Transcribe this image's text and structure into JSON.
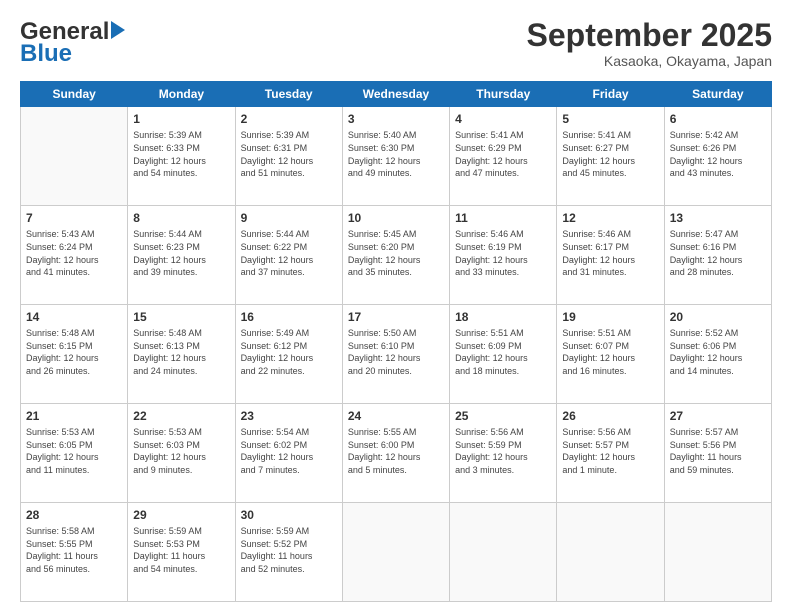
{
  "header": {
    "logo_general": "General",
    "logo_blue": "Blue",
    "month_title": "September 2025",
    "location": "Kasaoka, Okayama, Japan"
  },
  "days_of_week": [
    "Sunday",
    "Monday",
    "Tuesday",
    "Wednesday",
    "Thursday",
    "Friday",
    "Saturday"
  ],
  "weeks": [
    [
      {
        "num": "",
        "info": ""
      },
      {
        "num": "1",
        "info": "Sunrise: 5:39 AM\nSunset: 6:33 PM\nDaylight: 12 hours\nand 54 minutes."
      },
      {
        "num": "2",
        "info": "Sunrise: 5:39 AM\nSunset: 6:31 PM\nDaylight: 12 hours\nand 51 minutes."
      },
      {
        "num": "3",
        "info": "Sunrise: 5:40 AM\nSunset: 6:30 PM\nDaylight: 12 hours\nand 49 minutes."
      },
      {
        "num": "4",
        "info": "Sunrise: 5:41 AM\nSunset: 6:29 PM\nDaylight: 12 hours\nand 47 minutes."
      },
      {
        "num": "5",
        "info": "Sunrise: 5:41 AM\nSunset: 6:27 PM\nDaylight: 12 hours\nand 45 minutes."
      },
      {
        "num": "6",
        "info": "Sunrise: 5:42 AM\nSunset: 6:26 PM\nDaylight: 12 hours\nand 43 minutes."
      }
    ],
    [
      {
        "num": "7",
        "info": "Sunrise: 5:43 AM\nSunset: 6:24 PM\nDaylight: 12 hours\nand 41 minutes."
      },
      {
        "num": "8",
        "info": "Sunrise: 5:44 AM\nSunset: 6:23 PM\nDaylight: 12 hours\nand 39 minutes."
      },
      {
        "num": "9",
        "info": "Sunrise: 5:44 AM\nSunset: 6:22 PM\nDaylight: 12 hours\nand 37 minutes."
      },
      {
        "num": "10",
        "info": "Sunrise: 5:45 AM\nSunset: 6:20 PM\nDaylight: 12 hours\nand 35 minutes."
      },
      {
        "num": "11",
        "info": "Sunrise: 5:46 AM\nSunset: 6:19 PM\nDaylight: 12 hours\nand 33 minutes."
      },
      {
        "num": "12",
        "info": "Sunrise: 5:46 AM\nSunset: 6:17 PM\nDaylight: 12 hours\nand 31 minutes."
      },
      {
        "num": "13",
        "info": "Sunrise: 5:47 AM\nSunset: 6:16 PM\nDaylight: 12 hours\nand 28 minutes."
      }
    ],
    [
      {
        "num": "14",
        "info": "Sunrise: 5:48 AM\nSunset: 6:15 PM\nDaylight: 12 hours\nand 26 minutes."
      },
      {
        "num": "15",
        "info": "Sunrise: 5:48 AM\nSunset: 6:13 PM\nDaylight: 12 hours\nand 24 minutes."
      },
      {
        "num": "16",
        "info": "Sunrise: 5:49 AM\nSunset: 6:12 PM\nDaylight: 12 hours\nand 22 minutes."
      },
      {
        "num": "17",
        "info": "Sunrise: 5:50 AM\nSunset: 6:10 PM\nDaylight: 12 hours\nand 20 minutes."
      },
      {
        "num": "18",
        "info": "Sunrise: 5:51 AM\nSunset: 6:09 PM\nDaylight: 12 hours\nand 18 minutes."
      },
      {
        "num": "19",
        "info": "Sunrise: 5:51 AM\nSunset: 6:07 PM\nDaylight: 12 hours\nand 16 minutes."
      },
      {
        "num": "20",
        "info": "Sunrise: 5:52 AM\nSunset: 6:06 PM\nDaylight: 12 hours\nand 14 minutes."
      }
    ],
    [
      {
        "num": "21",
        "info": "Sunrise: 5:53 AM\nSunset: 6:05 PM\nDaylight: 12 hours\nand 11 minutes."
      },
      {
        "num": "22",
        "info": "Sunrise: 5:53 AM\nSunset: 6:03 PM\nDaylight: 12 hours\nand 9 minutes."
      },
      {
        "num": "23",
        "info": "Sunrise: 5:54 AM\nSunset: 6:02 PM\nDaylight: 12 hours\nand 7 minutes."
      },
      {
        "num": "24",
        "info": "Sunrise: 5:55 AM\nSunset: 6:00 PM\nDaylight: 12 hours\nand 5 minutes."
      },
      {
        "num": "25",
        "info": "Sunrise: 5:56 AM\nSunset: 5:59 PM\nDaylight: 12 hours\nand 3 minutes."
      },
      {
        "num": "26",
        "info": "Sunrise: 5:56 AM\nSunset: 5:57 PM\nDaylight: 12 hours\nand 1 minute."
      },
      {
        "num": "27",
        "info": "Sunrise: 5:57 AM\nSunset: 5:56 PM\nDaylight: 11 hours\nand 59 minutes."
      }
    ],
    [
      {
        "num": "28",
        "info": "Sunrise: 5:58 AM\nSunset: 5:55 PM\nDaylight: 11 hours\nand 56 minutes."
      },
      {
        "num": "29",
        "info": "Sunrise: 5:59 AM\nSunset: 5:53 PM\nDaylight: 11 hours\nand 54 minutes."
      },
      {
        "num": "30",
        "info": "Sunrise: 5:59 AM\nSunset: 5:52 PM\nDaylight: 11 hours\nand 52 minutes."
      },
      {
        "num": "",
        "info": ""
      },
      {
        "num": "",
        "info": ""
      },
      {
        "num": "",
        "info": ""
      },
      {
        "num": "",
        "info": ""
      }
    ]
  ]
}
